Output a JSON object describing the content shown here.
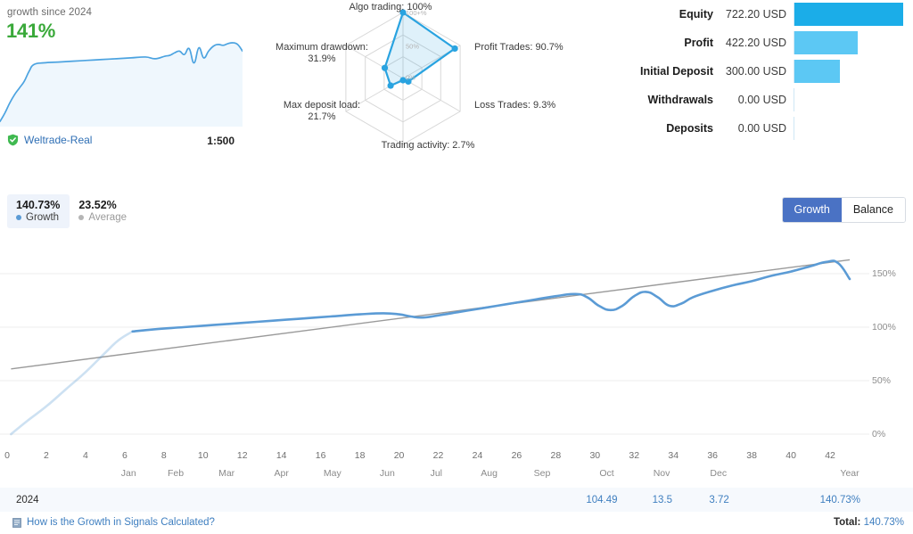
{
  "sparkline": {
    "since_label": "growth since 2024",
    "growth_pct": "141%",
    "broker": "Weltrade-Real",
    "broker_icon": "verified-shield-icon",
    "leverage": "1:500",
    "line_color": "#4ca3e0",
    "growth_color": "#3aa93a"
  },
  "radar": {
    "axes": [
      {
        "key": "algo",
        "label": "Algo trading: 100%",
        "value": 100
      },
      {
        "key": "profit",
        "label": "Profit Trades: 90.7%",
        "value": 90.7
      },
      {
        "key": "loss",
        "label": "Loss Trades: 9.3%",
        "value": 9.3
      },
      {
        "key": "activity",
        "label": "Trading activity: 2.7%",
        "value": 2.7
      },
      {
        "key": "maxdep",
        "label": "Max deposit load:\n21.7%",
        "value": 21.7
      },
      {
        "key": "maxdd",
        "label": "Maximum drawdown:\n31.9%",
        "value": 31.9
      }
    ],
    "ring_labels": {
      "outer": "100+%",
      "middle": "50%",
      "inner": "0%"
    },
    "accent": "#29a3e0"
  },
  "stats": {
    "rows": [
      {
        "label": "Equity",
        "value": "722.20 USD",
        "ratio": 1.0,
        "color": "#1bade8"
      },
      {
        "label": "Profit",
        "value": "422.20 USD",
        "ratio": 0.585,
        "color": "#5cc8f4"
      },
      {
        "label": "Initial Deposit",
        "value": "300.00 USD",
        "ratio": 0.415,
        "color": "#5cc8f4"
      },
      {
        "label": "Withdrawals",
        "value": "0.00 USD",
        "ratio": 0.0,
        "color": "#5cc8f4"
      },
      {
        "label": "Deposits",
        "value": "0.00 USD",
        "ratio": 0.0,
        "color": "#5cc8f4"
      }
    ]
  },
  "legend": {
    "growth_value": "140.73%",
    "growth_label": "Growth",
    "growth_color": "#5b9bd5",
    "average_value": "23.52%",
    "average_label": "Average",
    "average_color": "#b5b5b5"
  },
  "toggle": {
    "growth_label": "Growth",
    "balance_label": "Balance",
    "active": "Growth",
    "active_color": "#4a72c4"
  },
  "footer": {
    "link_text": "How is the Growth in Signals Calculated?",
    "link_icon": "book-icon",
    "total_label": "Total:",
    "total_value": "140.73%"
  },
  "table": {
    "row_label": "2024",
    "values": [
      "104.49",
      "13.5",
      "3.72",
      "140.73%"
    ]
  },
  "chart_data": {
    "type": "line",
    "title": "",
    "xlabel": "",
    "ylabel": "",
    "ylim": [
      0,
      175
    ],
    "yticks": [
      0,
      50,
      100,
      150
    ],
    "ytick_labels": [
      "0%",
      "50%",
      "100%",
      "150%"
    ],
    "xlim": [
      0,
      44
    ],
    "xticks": [
      0,
      2,
      4,
      6,
      8,
      10,
      12,
      14,
      16,
      18,
      20,
      22,
      24,
      26,
      28,
      30,
      32,
      34,
      36,
      38,
      40,
      42
    ],
    "xtick_labels": [
      "0",
      "2",
      "4",
      "6",
      "8",
      "10",
      "12",
      "14",
      "16",
      "18",
      "20",
      "22",
      "24",
      "26",
      "28",
      "30",
      "32",
      "34",
      "36",
      "38",
      "40",
      "42"
    ],
    "month_labels": [
      "Jan",
      "Feb",
      "Mar",
      "Apr",
      "May",
      "Jun",
      "Jul",
      "Aug",
      "Sep",
      "Oct",
      "Nov",
      "Dec",
      "Year"
    ],
    "month_positions": [
      6.2,
      8.6,
      11.2,
      14.0,
      16.6,
      19.4,
      21.9,
      24.6,
      27.3,
      30.6,
      33.4,
      36.3,
      43.0
    ],
    "grid": true,
    "legend_position": "top-left",
    "series": [
      {
        "name": "Growth",
        "color": "#5b9bd5",
        "faded_until_x": 6.4,
        "x": [
          0.2,
          1.0,
          2.0,
          3.0,
          4.0,
          5.0,
          5.7,
          6.4,
          7.5,
          9.0,
          10.5,
          12.0,
          13.5,
          15.0,
          16.5,
          18.0,
          19.2,
          20.0,
          20.6,
          21.2,
          22.0,
          23.0,
          24.0,
          25.0,
          26.0,
          27.0,
          28.0,
          29.0,
          29.6,
          30.2,
          30.8,
          31.4,
          32.0,
          32.6,
          33.2,
          33.8,
          34.4,
          35.0,
          36.0,
          37.0,
          38.0,
          39.0,
          40.0,
          41.0,
          41.8,
          42.4,
          43.0
        ],
        "y": [
          0,
          12,
          26,
          42,
          58,
          76,
          88,
          96,
          98,
          100,
          102,
          104,
          106,
          108,
          110,
          112,
          113,
          112,
          110,
          109,
          111,
          114,
          117,
          120,
          123,
          126,
          129,
          131,
          128,
          120,
          116,
          120,
          129,
          133,
          128,
          120,
          122,
          128,
          134,
          139,
          143,
          148,
          152,
          157,
          161,
          160,
          145
        ]
      },
      {
        "name": "Average",
        "color": "#9a9a9a",
        "x": [
          0.2,
          43.0
        ],
        "y": [
          61,
          163
        ]
      }
    ],
    "sparkline": {
      "name": "Sparkline growth",
      "color": "#4ca3e0",
      "fill": "#eaf4fc",
      "x": [
        0,
        2,
        4,
        6,
        8,
        10,
        12,
        14,
        18,
        24,
        30,
        36,
        42,
        48,
        54,
        60,
        64,
        68,
        70,
        72,
        74,
        76,
        78,
        80,
        82,
        84,
        86,
        88,
        90,
        92,
        94,
        96,
        98,
        100
      ],
      "y": [
        4,
        14,
        26,
        36,
        44,
        52,
        64,
        72,
        74,
        75,
        76,
        77,
        78,
        79,
        80,
        81,
        79,
        82,
        83,
        86,
        88,
        84,
        91,
        74,
        92,
        80,
        88,
        94,
        96,
        95,
        97,
        98,
        96,
        88
      ]
    }
  }
}
